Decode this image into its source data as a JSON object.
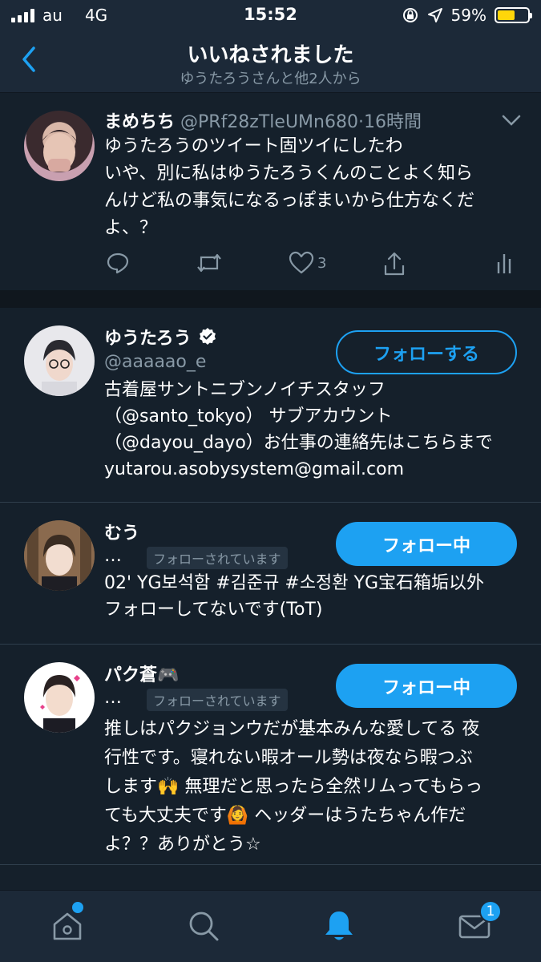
{
  "status_bar": {
    "carrier": "au",
    "network": "4G",
    "time": "15:52",
    "battery_percent": "59%",
    "battery_level": 0.59
  },
  "header": {
    "title": "いいねされました",
    "subtitle": "ゆうたろうさんと他2人から"
  },
  "tweet": {
    "author_name": "まめちち",
    "handle": "@PRf28zTleUMn680",
    "separator": "·",
    "time_ago": "16時間",
    "lines": [
      "ゆうたろうのツイート固ツイにしたわ",
      "いや、別に私はゆうたろうくんのことよく知ら",
      "んけど私の事気になるっぽまいから仕方なくだ",
      "よ、？"
    ],
    "like_count": "3"
  },
  "users": [
    {
      "name": "ゆうたろう",
      "handle": "@aaaaao_e",
      "verified": true,
      "button_label": "フォローする",
      "bio_lines": [
        "古着屋サントニブンノイチスタッフ",
        "（@santo_tokyo） サブアカウント",
        "（@dayou_dayo）お仕事の連絡先はこちらまで",
        "yutarou.asobysystem@gmail.com"
      ]
    },
    {
      "name": "むう",
      "handle_truncated": "…",
      "follows_you": "フォローされています",
      "button_label": "フォロー中",
      "bio_lines": [
        "02' YG보석함 #김준규 #소정환 YG宝石箱垢以外",
        "フォローしてないです(ToT)"
      ]
    },
    {
      "name": "パク蒼🎮",
      "handle_truncated": "…",
      "follows_you": "フォローされています",
      "button_label": "フォロー中",
      "bio_lines": [
        "推しはパクジョンウだが基本みんな愛してる 夜",
        "行性です。寝れない暇オール勢は夜なら暇つぶ",
        "します🙌 無理だと思ったら全然リムってもらっ",
        "ても大丈夫です🙆 ヘッダーはうたちゃん作だ",
        "よ？？ありがとう☆"
      ]
    }
  ],
  "tabbar": {
    "messages_badge": "1"
  },
  "colors": {
    "background": "#15202b",
    "accent": "#1da1f2",
    "muted": "#8899a6",
    "battery": "#ffd60a"
  },
  "icons": [
    "back-arrow-icon",
    "caret-down-icon",
    "reply-icon",
    "retweet-icon",
    "heart-icon",
    "share-icon",
    "analytics-icon",
    "verified-badge-icon",
    "home-icon",
    "search-icon",
    "bell-icon",
    "mail-icon"
  ]
}
